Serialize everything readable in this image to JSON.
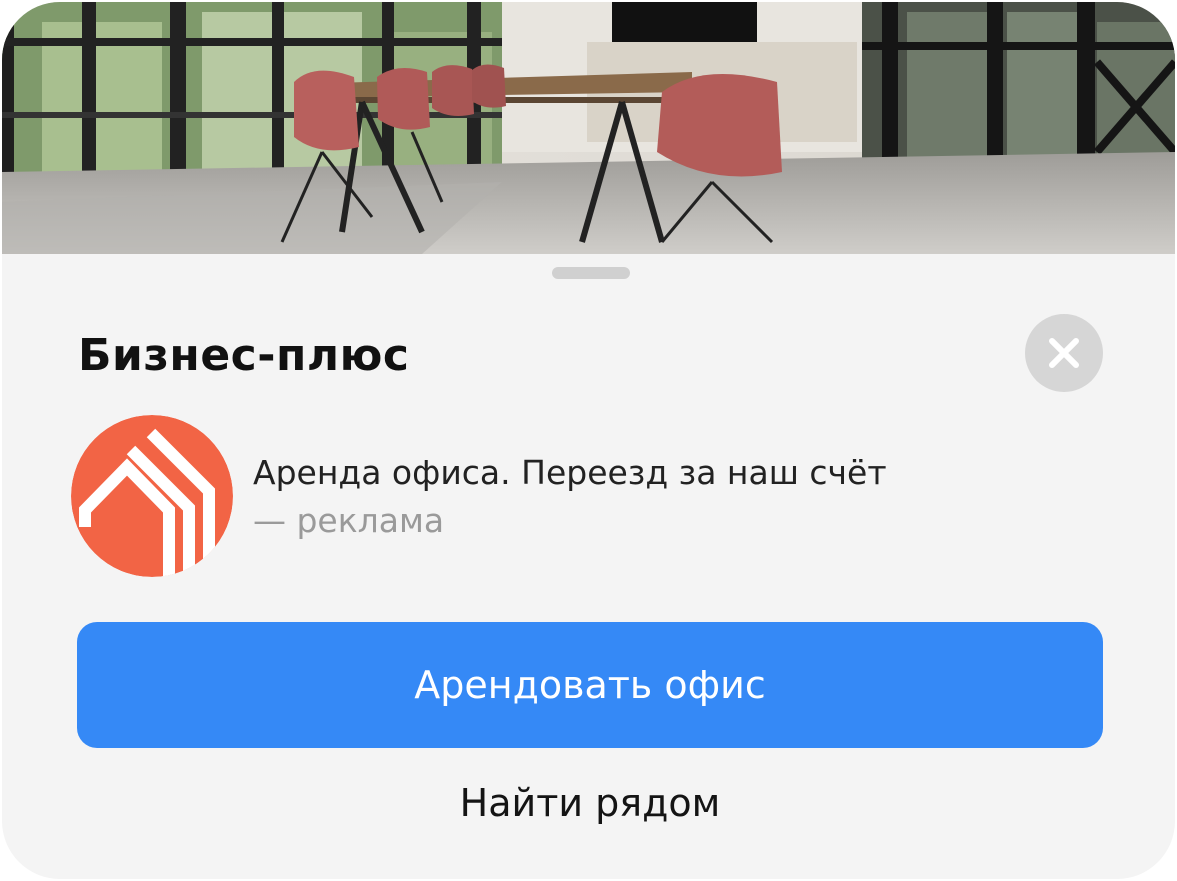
{
  "banner": {
    "image": "office-meeting-room-photo"
  },
  "sheet": {
    "title": "Бизнес-плюс",
    "close_icon": "close-icon"
  },
  "ad": {
    "logo": "house-logo-icon",
    "logo_color": "#f26445",
    "text": "Аренда офиса. Переезд за наш счёт",
    "label": "— реклама"
  },
  "actions": {
    "primary_label": "Арендовать офис",
    "primary_color": "#3589f6",
    "secondary_label": "Найти рядом"
  }
}
